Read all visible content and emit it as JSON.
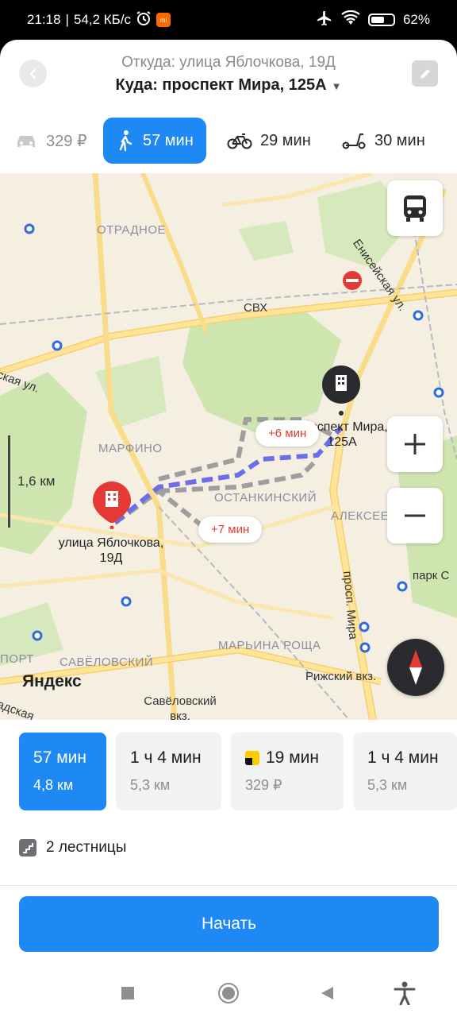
{
  "status_bar": {
    "time": "21:18",
    "network_speed": "54,2 КБ/с",
    "battery": "62",
    "battery_level": 0.62,
    "icons": [
      "alarm-icon",
      "mi-icon",
      "airplane-icon",
      "wifi-icon",
      "battery-icon"
    ]
  },
  "header": {
    "from": "Откуда: улица Яблочкова, 19Д",
    "to": "Куда: проспект Мира, 125А",
    "to_caret": "▼",
    "back_icon": "chevron-left-icon",
    "edit_icon": "pencil-icon"
  },
  "modes": [
    {
      "icon": "car-icon",
      "label": "329 ₽",
      "active": false
    },
    {
      "icon": "walk-icon",
      "label": "57 мин",
      "active": true
    },
    {
      "icon": "bicycle-icon",
      "label": "29 мин",
      "active": false
    },
    {
      "icon": "scooter-icon",
      "label": "30 мин",
      "active": false
    }
  ],
  "map": {
    "labels": {
      "otradnoe": "ОТРАДНОЕ",
      "svh": "СВХ",
      "eniseyskaya": "Енисейская ул.",
      "marfino": "МАРФИНО",
      "ostankinsky": "ОСТАНКИНСКИЙ",
      "alekseevsky": "АЛЕКСЕЕВ",
      "maryina_roshcha": "МАРЬИНА РОЩА",
      "savelovsky": "САВЁЛОВСКИЙ",
      "port": "ПОРТ",
      "prosp_mira": "просп. Мира",
      "park": "парк С",
      "rizhsky": "Рижский вкз.",
      "savelovsky_vkz": "Савёловский вкз.",
      "kaya_ul": "ская ул.",
      "dskaya": "адская"
    },
    "origin_label": "улица Яблочкова, 19Д",
    "destination_label": "проспект Мира, 125А",
    "chips": {
      "plus6": "+6 мин",
      "plus7": "+7 мин"
    },
    "scale": "1,6 км",
    "logo": "Яндекс",
    "buttons": {
      "transit": "bus-icon",
      "zoom_in": "+",
      "zoom_out": "−",
      "compass": "compass-icon"
    }
  },
  "options": [
    {
      "line1": "57 мин",
      "line2": "4,8 км",
      "active": true,
      "taxi": false
    },
    {
      "line1": "1 ч 4 мин",
      "line2": "5,3 км",
      "active": false,
      "taxi": false
    },
    {
      "line1": "19 мин",
      "line2": "329 ₽",
      "active": false,
      "taxi": true
    },
    {
      "line1": "1 ч 4 мин",
      "line2": "5,3 км",
      "active": false,
      "taxi": false
    }
  ],
  "stairs": "2 лестницы",
  "start_button": "Начать",
  "navbar": [
    "square-icon",
    "home-circle-icon",
    "back-triangle-icon",
    "accessibility-icon"
  ],
  "colors": {
    "accent": "#1e88f5",
    "route": "#6b6ee8",
    "alt_route": "#9e9e9e",
    "pin_red": "#e53935"
  }
}
